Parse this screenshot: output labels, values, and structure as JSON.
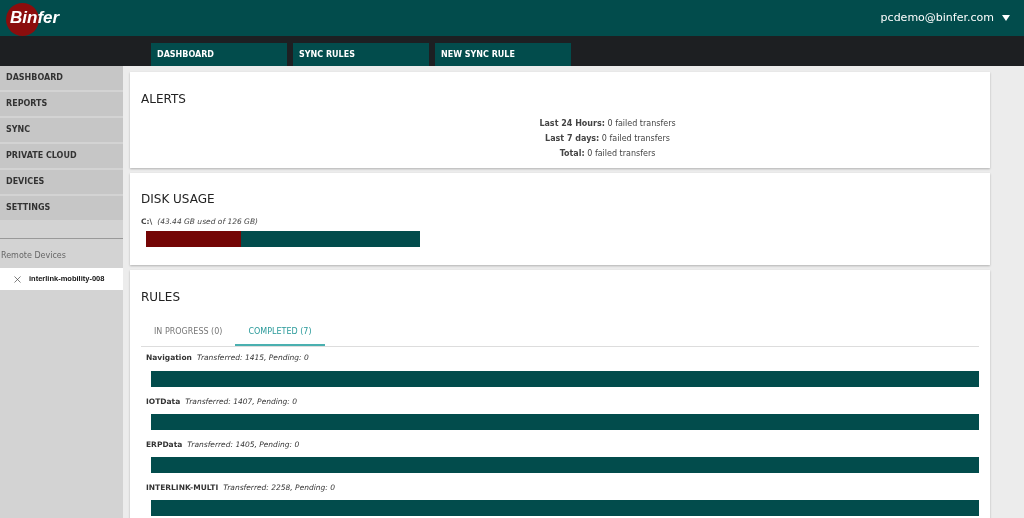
{
  "header": {
    "logo": "Binfer",
    "user": "pcdemo@binfer.com"
  },
  "tabs": [
    {
      "label": "DASHBOARD",
      "selected": false
    },
    {
      "label": "SYNC RULES",
      "selected": false
    },
    {
      "label": "NEW SYNC RULE",
      "selected": false
    }
  ],
  "sidebar": {
    "items": [
      {
        "label": "DASHBOARD"
      },
      {
        "label": "REPORTS"
      },
      {
        "label": "SYNC"
      },
      {
        "label": "PRIVATE CLOUD"
      },
      {
        "label": "DEVICES"
      },
      {
        "label": "SETTINGS"
      }
    ],
    "remote_title": "Remote Devices",
    "devices": [
      {
        "name": "interlink-mobility-008"
      }
    ]
  },
  "alerts": {
    "title": "ALERTS",
    "lines": [
      "**Last 24 Hours:** 0 failed transfers",
      "**Last 7 days:** 0 failed transfers",
      "**Total:** 0 failed transfers"
    ]
  },
  "disk": {
    "title": "DISK USAGE",
    "drive": "C:\\",
    "detail": "(43.44 GB used of 126 GB)",
    "level": 0.345
  },
  "rules": {
    "title": "RULES",
    "tabs": [
      {
        "label": "IN PROGRESS (0)",
        "selected": false
      },
      {
        "label": "COMPLETED (7)",
        "selected": true
      }
    ],
    "items": [
      {
        "name": "Navigation",
        "detail": "Transferred: 1415, Pending: 0",
        "level": 1
      },
      {
        "name": "IOTData",
        "detail": "Transferred: 1407, Pending: 0",
        "level": 1
      },
      {
        "name": "ERPData",
        "detail": "Transferred: 1405, Pending: 0",
        "level": 1
      },
      {
        "name": "INTERLINK-MULTI",
        "detail": "Transferred: 2258, Pending: 0",
        "level": 1
      }
    ]
  }
}
